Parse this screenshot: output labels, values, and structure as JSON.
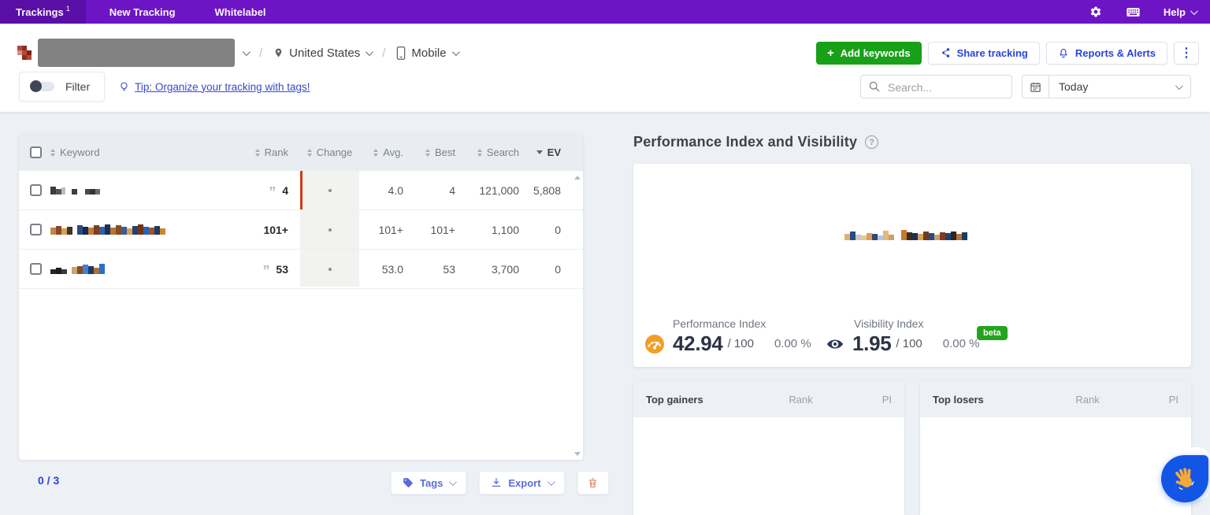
{
  "glyphs": {
    "kebab": "⋮",
    "quote": "”",
    "question": "?",
    "slash": "/",
    "plus": "+"
  },
  "topnav": {
    "items": [
      {
        "label": "Trackings",
        "badge": "1"
      },
      {
        "label": "New Tracking"
      },
      {
        "label": "Whitelabel"
      }
    ],
    "help_label": "Help"
  },
  "header": {
    "location": "United States",
    "device": "Mobile",
    "add_keywords_label": "Add keywords",
    "share_label": "Share tracking",
    "reports_label": "Reports & Alerts"
  },
  "toolbar": {
    "filter_label": "Filter",
    "tip_link": "Tip: Organize your tracking with tags!",
    "search_placeholder": "Search...",
    "date_value": "Today"
  },
  "table": {
    "columns": {
      "keyword": "Keyword",
      "rank": "Rank",
      "change": "Change",
      "avg": "Avg.",
      "best": "Best",
      "search": "Search",
      "ev": "EV"
    },
    "rows": [
      {
        "rank": "4",
        "avg": "4.0",
        "best": "4",
        "search": "121,000",
        "ev": "5,808"
      },
      {
        "rank": "101+",
        "avg": "101+",
        "best": "101+",
        "search": "1,100",
        "ev": "0"
      },
      {
        "rank": "53",
        "avg": "53.0",
        "best": "53",
        "search": "3,700",
        "ev": "0"
      }
    ],
    "selected_count": "0 / 3",
    "tags_label": "Tags",
    "export_label": "Export"
  },
  "panel": {
    "title": "Performance Index and Visibility",
    "performance_label": "Performance Index",
    "performance_value": "42.94",
    "performance_max": "/ 100",
    "performance_change": "0.00 %",
    "visibility_label": "Visibility Index",
    "visibility_value": "1.95",
    "visibility_max": "/ 100",
    "visibility_change": "0.00 %",
    "beta_label": "beta",
    "gainers_title": "Top gainers",
    "losers_title": "Top losers",
    "rank_col": "Rank",
    "pi_col": "PI"
  },
  "colors": {
    "accent_blue": "#2b44d8",
    "green": "#18a019",
    "purple": "#6d15c4",
    "orange": "#f49d26",
    "navy": "#2b3a57",
    "beta_green": "#23a41f",
    "red_marker": "#cf3a17"
  }
}
